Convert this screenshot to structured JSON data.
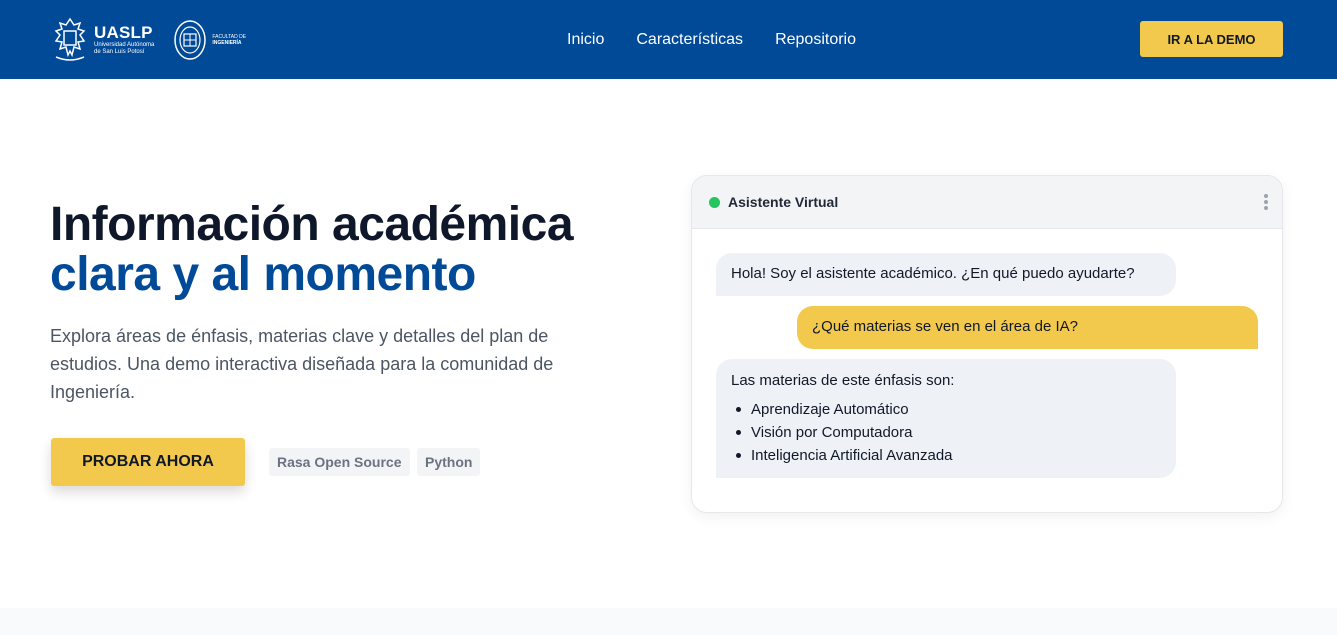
{
  "header": {
    "brand": {
      "uaslp_title": "UASLP",
      "uaslp_sub1": "Universidad Autónoma",
      "uaslp_sub2": "de San Luis Potosí",
      "fi_line1": "FACULTAD DE",
      "fi_line2": "INGENIERÍA"
    },
    "nav": [
      {
        "label": "Inicio"
      },
      {
        "label": "Características"
      },
      {
        "label": "Repositorio"
      }
    ],
    "demo_button": "IR A LA DEMO"
  },
  "hero": {
    "title_line1": "Información académica",
    "title_line2": "clara y al momento",
    "description": "Explora áreas de énfasis, materias clave y detalles del plan de estudios. Una demo interactiva diseñada para la comunidad de Ingeniería.",
    "cta": "PROBAR AHORA",
    "tags": [
      "Rasa Open Source",
      "Python"
    ]
  },
  "chat": {
    "title": "Asistente Virtual",
    "status_color": "#22c55e",
    "messages": {
      "bot_greeting": "Hola! Soy el asistente académico. ¿En qué puedo ayudarte?",
      "user_question": "¿Qué materias se ven en el área de IA?",
      "bot_answer_intro": "Las materias de este énfasis son:",
      "bot_answer_items": [
        "Aprendizaje Automático",
        "Visión por Computadora",
        "Inteligencia Artificial Avanzada"
      ]
    }
  },
  "colors": {
    "primary": "#004a98",
    "accent": "#f2c94c"
  }
}
